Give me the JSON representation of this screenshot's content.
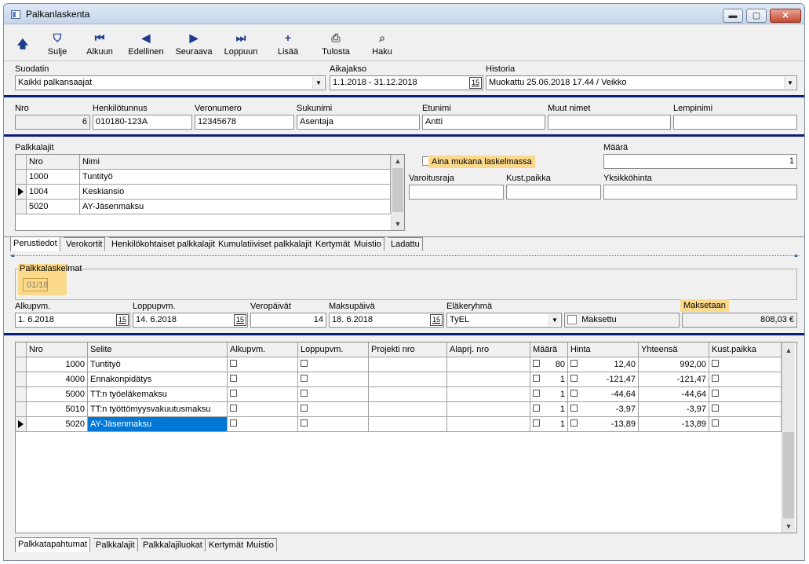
{
  "window": {
    "title": "Palkanlaskenta",
    "min": "▬",
    "max": "▢",
    "close": "✕"
  },
  "toolbar": [
    {
      "id": "up",
      "label": "",
      "icon": "arrow-up"
    },
    {
      "id": "sulje",
      "label": "Sulje",
      "icon": "door-close"
    },
    {
      "id": "alkuun",
      "label": "Alkuun",
      "icon": "first"
    },
    {
      "id": "edellinen",
      "label": "Edellinen",
      "icon": "prev"
    },
    {
      "id": "seuraava",
      "label": "Seuraava",
      "icon": "next"
    },
    {
      "id": "loppuun",
      "label": "Loppuun",
      "icon": "last"
    },
    {
      "id": "lisaa",
      "label": "Lisää",
      "icon": "plus"
    },
    {
      "id": "tulosta",
      "label": "Tulosta",
      "icon": "printer"
    },
    {
      "id": "haku",
      "label": "Haku",
      "icon": "search"
    }
  ],
  "filter": {
    "suodatin_label": "Suodatin",
    "suodatin_value": "Kaikki palkansaajat",
    "aikajakso_label": "Aikajakso",
    "aikajakso_value": "1.1.2018 - 31.12.2018",
    "historia_label": "Historia",
    "historia_value": "Muokattu 25.06.2018 17.44 / Veikko",
    "cal_text": "15"
  },
  "person": {
    "nro_label": "Nro",
    "nro_value": "6",
    "hetu_label": "Henkilötunnus",
    "hetu_value": "010180-123A",
    "vero_label": "Veronumero",
    "vero_value": "12345678",
    "suku_label": "Sukunimi",
    "suku_value": "Asentaja",
    "etu_label": "Etunimi",
    "etu_value": "Antti",
    "muut_label": "Muut nimet",
    "muut_value": "",
    "lempi_label": "Lempinimi",
    "lempi_value": ""
  },
  "palkkalajit": {
    "label": "Palkkalajit",
    "col_nro": "Nro",
    "col_nimi": "Nimi",
    "rows": [
      {
        "nro": "1000",
        "nimi": "Tuntityö"
      },
      {
        "nro": "1004",
        "nimi": "Keskiansio"
      },
      {
        "nro": "5020",
        "nimi": "AY-Jäsenmaksu"
      }
    ],
    "aina_label": "Aina mukana laskelmassa",
    "maara_label": "Määrä",
    "maara_value": "1",
    "varoitus_label": "Varoitusraja",
    "kust_label": "Kust.paikka",
    "yks_label": "Yksikköhinta"
  },
  "tabs1": [
    "Perustiedot",
    "Verokortit",
    "Henkilökohtaiset palkkalajit",
    "Kumulatiiviset palkkalajit",
    "Kertymät",
    "Muistio",
    "Ladattu"
  ],
  "laskelmat": {
    "label": "Palkkalaskelmat",
    "value": "01/18"
  },
  "calc": {
    "alku_label": "Alkupvm.",
    "alku_value": "1. 6.2018",
    "loppu_label": "Loppupvm.",
    "loppu_value": "14. 6.2018",
    "vero_label": "Veropäivät",
    "vero_value": "14",
    "maksu_label": "Maksupäivä",
    "maksu_value": "18. 6.2018",
    "elake_label": "Eläkeryhmä",
    "elake_value": "TyEL",
    "maksettu_label": "Maksettu",
    "maksetaan_label": "Maksetaan",
    "maksetaan_value": "808,03 €"
  },
  "events": {
    "headers": [
      "Nro",
      "Selite",
      "Alkupvm.",
      "Loppupvm.",
      "Projekti nro",
      "Alaprj. nro",
      "Määrä",
      "Hinta",
      "Yhteensä",
      "Kust.paikka"
    ],
    "rows": [
      {
        "nro": "1000",
        "selite": "Tuntityö",
        "maara": "80",
        "hinta": "12,40",
        "yht": "992,00"
      },
      {
        "nro": "4000",
        "selite": "Ennakonpidätys",
        "maara": "1",
        "hinta": "-121,47",
        "yht": "-121,47"
      },
      {
        "nro": "5000",
        "selite": "TT:n työeläkemaksu",
        "maara": "1",
        "hinta": "-44,64",
        "yht": "-44,64"
      },
      {
        "nro": "5010",
        "selite": "TT:n työttömyysvakuutusmaksu",
        "maara": "1",
        "hinta": "-3,97",
        "yht": "-3,97"
      },
      {
        "nro": "5020",
        "selite": "AY-Jäsenmaksu",
        "maara": "1",
        "hinta": "-13,89",
        "yht": "-13,89"
      }
    ],
    "selected_row": 4
  },
  "tabs2": [
    "Palkkatapahtumat",
    "Palkkalajit",
    "Palkkalajiluokat",
    "Kertymät",
    "Muistio"
  ],
  "colors": {
    "separator": "#0a1f78",
    "highlight": "#fbd98a",
    "selection": "#0078d7"
  }
}
